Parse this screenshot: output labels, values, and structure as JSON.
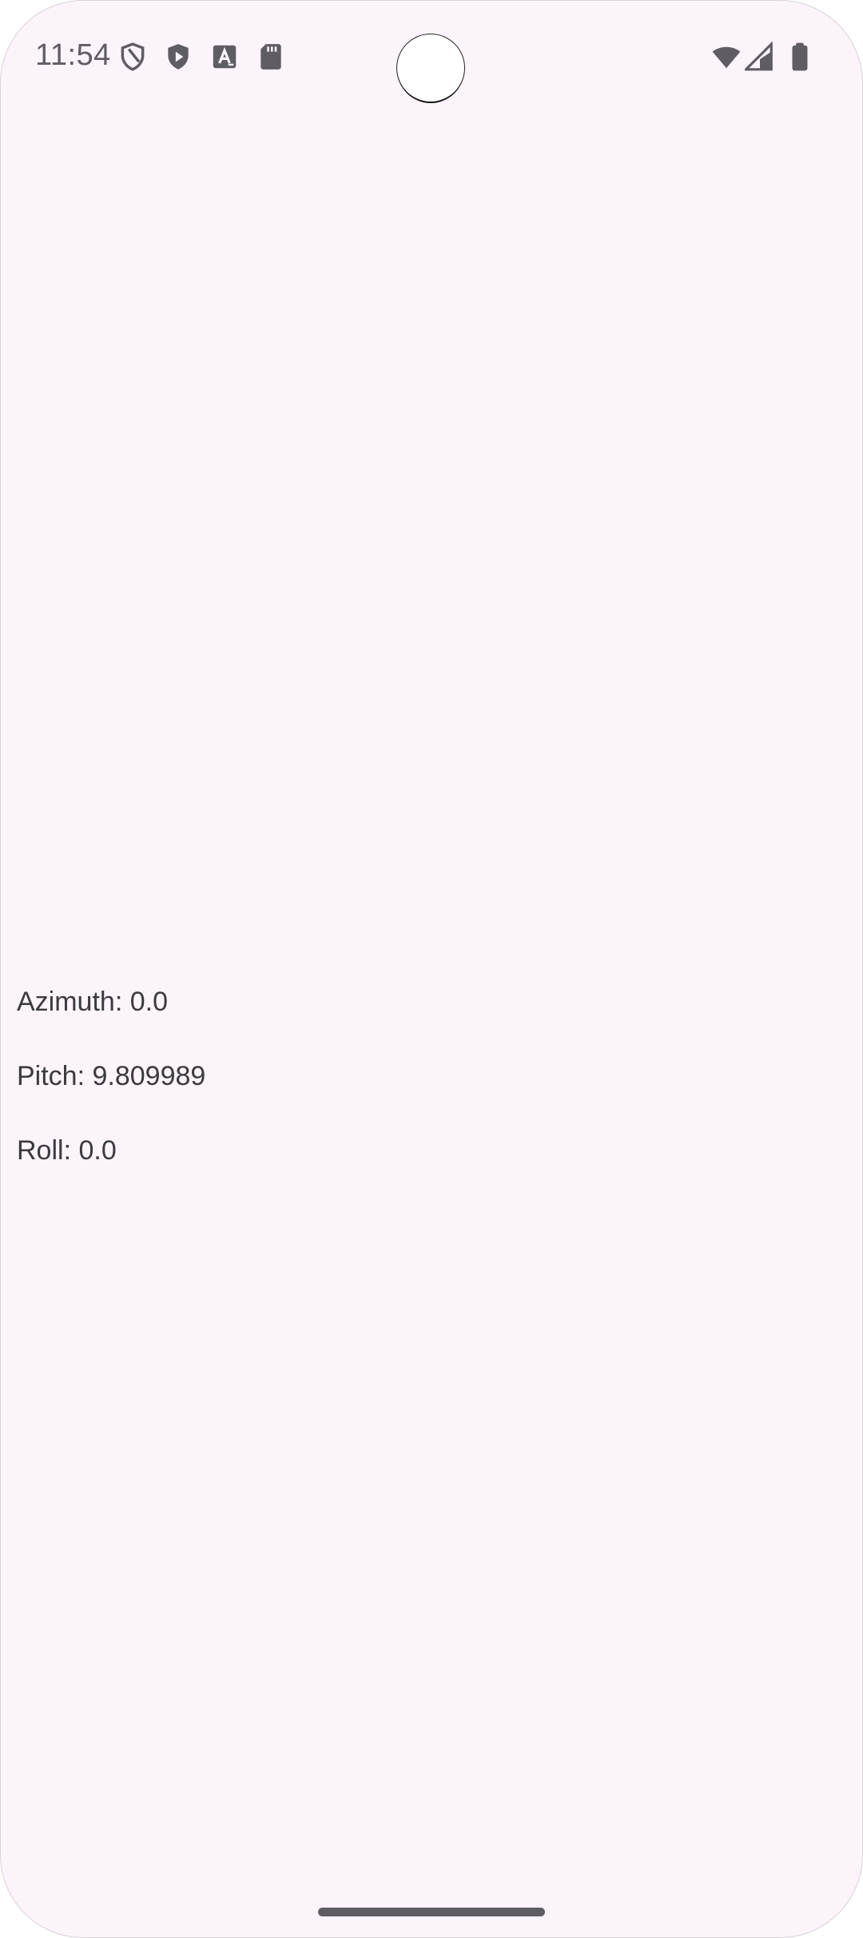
{
  "status_bar": {
    "time": "11:54",
    "left_icons": [
      "shield-outline-icon",
      "play-shield-icon",
      "font-a-icon",
      "sd-card-icon"
    ],
    "right_icons": [
      "wifi-icon",
      "cellular-signal-icon",
      "battery-icon"
    ],
    "icon_color": "#5f5d63"
  },
  "sensor_readings": {
    "azimuth": "Azimuth: 0.0",
    "pitch": "Pitch: 9.809989",
    "roll": "Roll: 0.0"
  },
  "colors": {
    "background": "#fcf4fb",
    "text": "#3b3a3f"
  }
}
